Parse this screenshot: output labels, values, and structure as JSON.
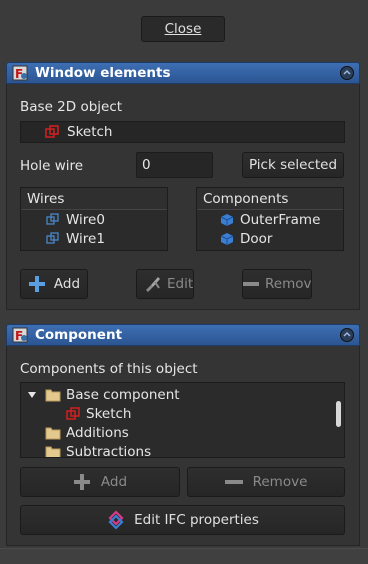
{
  "close_button": "Close",
  "window_elements": {
    "title": "Window elements",
    "base_label": "Base 2D object",
    "base_value": "Sketch",
    "hole_wire_label": "Hole wire",
    "hole_wire_value": "0",
    "pick_selected": "Pick selected",
    "wires_header": "Wires",
    "wires": [
      "Wire0",
      "Wire1"
    ],
    "components_header": "Components",
    "components": [
      "OuterFrame",
      "Door"
    ],
    "add": "Add",
    "edit": "Edit",
    "remove": "Remov"
  },
  "component": {
    "title": "Component",
    "list_label": "Components of this object",
    "tree": {
      "base": "Base component",
      "sketch": "Sketch",
      "additions": "Additions",
      "subtractions": "Subtractions"
    },
    "add": "Add",
    "remove": "Remove",
    "edit_ifc": "Edit IFC properties"
  },
  "colors": {
    "header_blue": "#2c5592",
    "sketch_red": "#d32020",
    "wire_blue": "#4a86c8",
    "part_blue": "#3a7fd4",
    "folder": "#e3c98e"
  }
}
